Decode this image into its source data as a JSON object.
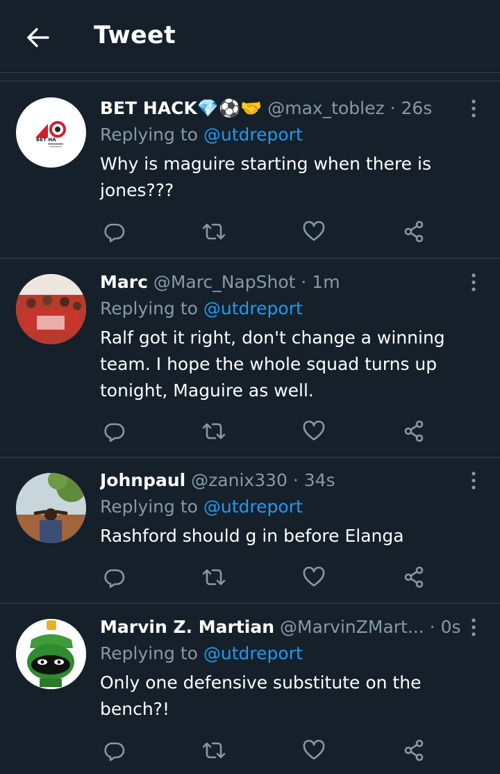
{
  "header": {
    "title": "Tweet"
  },
  "tweets": [
    {
      "name": "BET HACK💎⚽🤝",
      "handle": "@max_toblez",
      "dot": "·",
      "time": "26s",
      "replying_prefix": "Replying to",
      "replying_to": "@utdreport",
      "text": "Why is maguire starting when there is jones???",
      "avatar_text": "BET HA"
    },
    {
      "name": "Marc",
      "handle": "@Marc_NapShot",
      "dot": "·",
      "time": "1m",
      "replying_prefix": "Replying to",
      "replying_to": "@utdreport",
      "text": "Ralf got it right, don't change a winning team. I hope the whole squad turns up tonight, Maguire as well."
    },
    {
      "name": "Johnpaul",
      "handle": "@zanix330",
      "dot": "·",
      "time": "34s",
      "replying_prefix": "Replying to",
      "replying_to": "@utdreport",
      "text": "Rashford should g in before Elanga"
    },
    {
      "name": "Marvin Z. Martian",
      "handle": "@MarvinZMart...",
      "dot": "·",
      "time": "0s",
      "replying_prefix": "Replying to",
      "replying_to": "@utdreport",
      "text": "Only one defensive substitute on the bench?!"
    }
  ],
  "icons": {
    "back": "arrow-left-icon",
    "more": "more-vertical-icon",
    "reply": "reply-icon",
    "retweet": "retweet-icon",
    "like": "heart-icon",
    "share": "share-icon"
  },
  "colors": {
    "background": "#15202b",
    "divider": "#38444d",
    "secondary_text": "#8899a6",
    "mention": "#1d9bf0"
  }
}
